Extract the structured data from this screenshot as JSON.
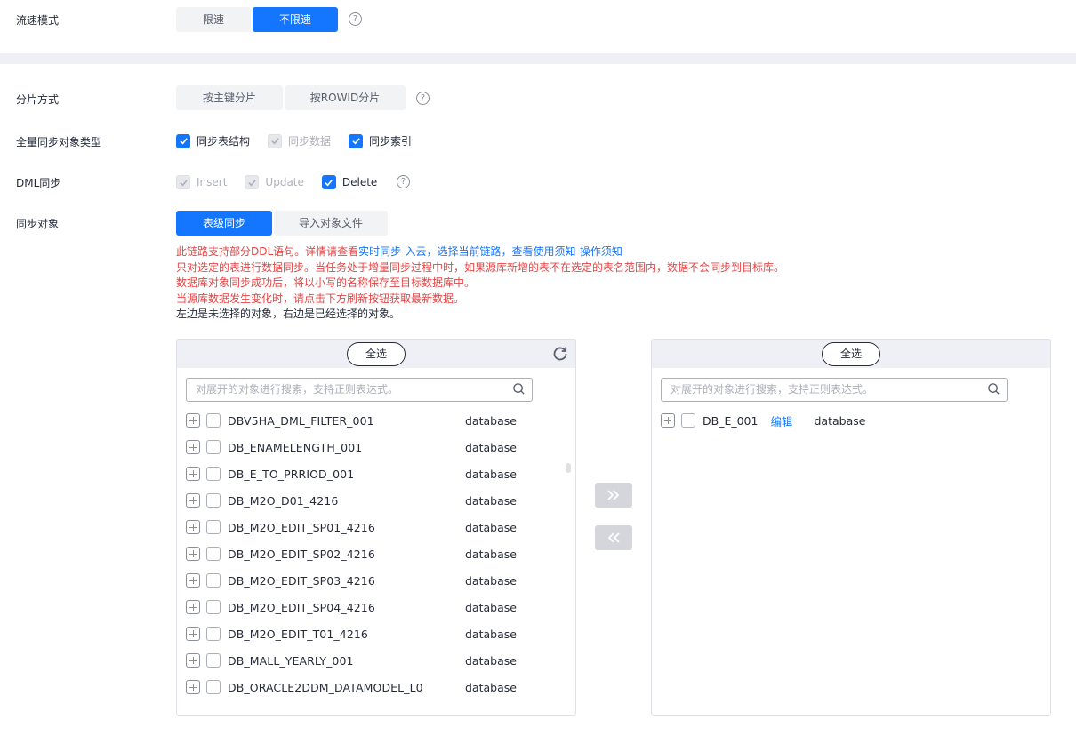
{
  "flow_mode": {
    "label": "流速模式",
    "options": [
      "限速",
      "不限速"
    ],
    "active": "不限速"
  },
  "shard_mode": {
    "label": "分片方式",
    "options": [
      "按主键分片",
      "按ROWID分片"
    ]
  },
  "full_sync": {
    "label": "全量同步对象类型",
    "items": [
      {
        "label": "同步表结构",
        "state": "checked"
      },
      {
        "label": "同步数据",
        "state": "disabled"
      },
      {
        "label": "同步索引",
        "state": "checked"
      }
    ]
  },
  "dml_sync": {
    "label": "DML同步",
    "items": [
      {
        "label": "Insert",
        "state": "disabled"
      },
      {
        "label": "Update",
        "state": "disabled"
      },
      {
        "label": "Delete",
        "state": "checked"
      }
    ]
  },
  "sync_objects": {
    "label": "同步对象",
    "tabs": [
      "表级同步",
      "导入对象文件"
    ],
    "active_tab": "表级同步"
  },
  "notes": {
    "line1_prefix": "此链路支持部分DDL语句。详情请查看",
    "line1_link": "实时同步-入云，选择当前链路，查看使用须知-操作须知",
    "line2": "只对选定的表进行数据同步。当任务处于增量同步过程中时，如果源库新增的表不在选定的表名范围内，数据不会同步到目标库。",
    "line3": "数据库对象同步成功后，将以小写的名称保存至目标数据库中。",
    "line4": "当源库数据发生变化时，请点击下方刷新按钮获取最新数据。",
    "line5": "左边是未选择的对象，右边是已经选择的对象。"
  },
  "left_panel": {
    "select_all": "全选",
    "search_placeholder": "对展开的对象进行搜索，支持正则表达式。",
    "rows": [
      {
        "name": "DBV5HA_DML_FILTER_001",
        "type": "database"
      },
      {
        "name": "DB_ENAMELENGTH_001",
        "type": "database"
      },
      {
        "name": "DB_E_TO_PRRIOD_001",
        "type": "database"
      },
      {
        "name": "DB_M2O_D01_4216",
        "type": "database"
      },
      {
        "name": "DB_M2O_EDIT_SP01_4216",
        "type": "database"
      },
      {
        "name": "DB_M2O_EDIT_SP02_4216",
        "type": "database"
      },
      {
        "name": "DB_M2O_EDIT_SP03_4216",
        "type": "database"
      },
      {
        "name": "DB_M2O_EDIT_SP04_4216",
        "type": "database"
      },
      {
        "name": "DB_M2O_EDIT_T01_4216",
        "type": "database"
      },
      {
        "name": "DB_MALL_YEARLY_001",
        "type": "database"
      },
      {
        "name": "DB_ORACLE2DDM_DATAMODEL_L0",
        "type": "database"
      }
    ]
  },
  "right_panel": {
    "select_all": "全选",
    "search_placeholder": "对展开的对象进行搜索，支持正则表达式。",
    "rows": [
      {
        "name": "DB_E_001",
        "edit": "编辑",
        "type": "database"
      }
    ]
  },
  "icons": {
    "help": "question-circle-icon",
    "refresh": "refresh-icon",
    "search": "search-icon",
    "move_right": "double-chevron-right-icon",
    "move_left": "double-chevron-left-icon"
  },
  "colors": {
    "primary": "#1476ff",
    "warning_text": "#e54545",
    "disabled_button": "#d4d6db"
  }
}
